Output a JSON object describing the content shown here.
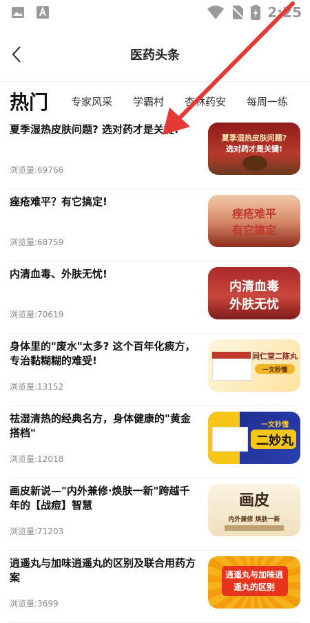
{
  "status_bar": {
    "time": "2:25"
  },
  "header": {
    "title": "医药头条"
  },
  "tabs": [
    {
      "label": "热门",
      "active": true
    },
    {
      "label": "专家风采"
    },
    {
      "label": "学霸村"
    },
    {
      "label": "杏林药安"
    },
    {
      "label": "每周一练"
    }
  ],
  "views_prefix": "浏览量:",
  "items": [
    {
      "title": "夏季湿热皮肤问题? 选对药才是关键!",
      "views": "浏览量:69766",
      "thumb": {
        "line1": "夏季湿热皮肤问题?",
        "line2": "选对药才是关键!"
      }
    },
    {
      "title": "痤疮难平？有它搞定!",
      "views": "浏览量:68759",
      "thumb": {
        "line1": "痤疮难平",
        "line2": "有它搞定"
      }
    },
    {
      "title": "内清血毒、外肤无忧!",
      "views": "浏览量:70619",
      "thumb": {
        "line1": "内清血毒",
        "line2": "外肤无忧"
      }
    },
    {
      "title": "身体里的\"废水\"太多? 这个百年化痰方，专治黏糊糊的难受!",
      "views": "浏览量:13152",
      "thumb": {
        "line1": "同仁堂二陈丸",
        "line2": "一文秒懂"
      }
    },
    {
      "title": "祛湿清热的经典名方，身体健康的\"黄金搭档\"",
      "views": "浏览量:12018",
      "thumb": {
        "line1": "一文秒懂",
        "line2": "二妙丸"
      }
    },
    {
      "title": "画皮新说—\"内外兼修·焕肤一新\"跨越千年的【战痘】智慧",
      "views": "浏览量:71203",
      "thumb": {
        "line1": "画皮",
        "line2": "内外兼修 焕肤一新"
      }
    },
    {
      "title": "逍遥丸与加味逍遥丸的区别及联合用药方案",
      "views": "浏览量:3699",
      "thumb": {
        "line1": "逍遥丸与加味逍",
        "line2": "遥丸的区别"
      }
    }
  ],
  "colors": {
    "accent_red": "#c0392b",
    "arrow": "#e53935"
  }
}
